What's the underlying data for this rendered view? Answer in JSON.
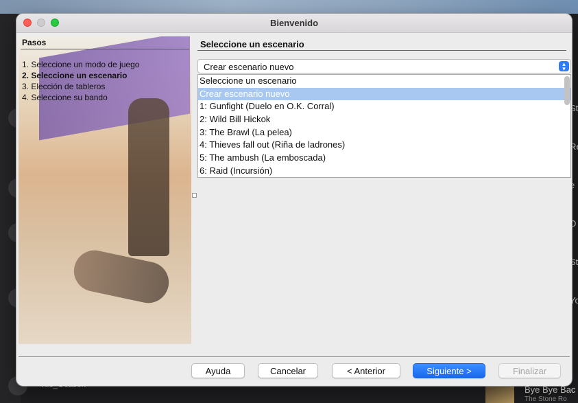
{
  "window": {
    "title": "Bienvenido"
  },
  "steps": {
    "heading": "Pasos",
    "items": [
      "1. Seleccione un modo de juego",
      "2. Seleccione un escenario",
      "3. Elección de tableros",
      "4. Seleccione su bando"
    ],
    "active_index": 1
  },
  "pane": {
    "heading": "Seleccione un escenario",
    "combo_value": "Crear escenario nuevo",
    "options": [
      "Seleccione un escenario",
      "Crear escenario nuevo",
      "1: Gunfight (Duelo en O.K. Corral)",
      "2: Wild Bill Hickok",
      "3: The Brawl (La pelea)",
      "4: Thieves fall out (Riña de ladrones)",
      "5: The ambush (La emboscada)",
      "6: Raid (Incursión)"
    ],
    "selected_option": "Crear escenario nuevo"
  },
  "buttons": {
    "help": "Ayuda",
    "cancel": "Cancelar",
    "back": "< Anterior",
    "next": "Siguiente >",
    "finish": "Finalizar"
  },
  "background_app": {
    "bottom_left": "Ric_Ocasek",
    "now_playing_title": "Bye Bye Bac",
    "now_playing_artist": "The Stone Ro",
    "right_letters": [
      "St",
      "Re",
      "e",
      "D",
      "St",
      "Yo"
    ]
  },
  "colors": {
    "accent": "#1769f2",
    "selection": "#a8c8f2"
  }
}
